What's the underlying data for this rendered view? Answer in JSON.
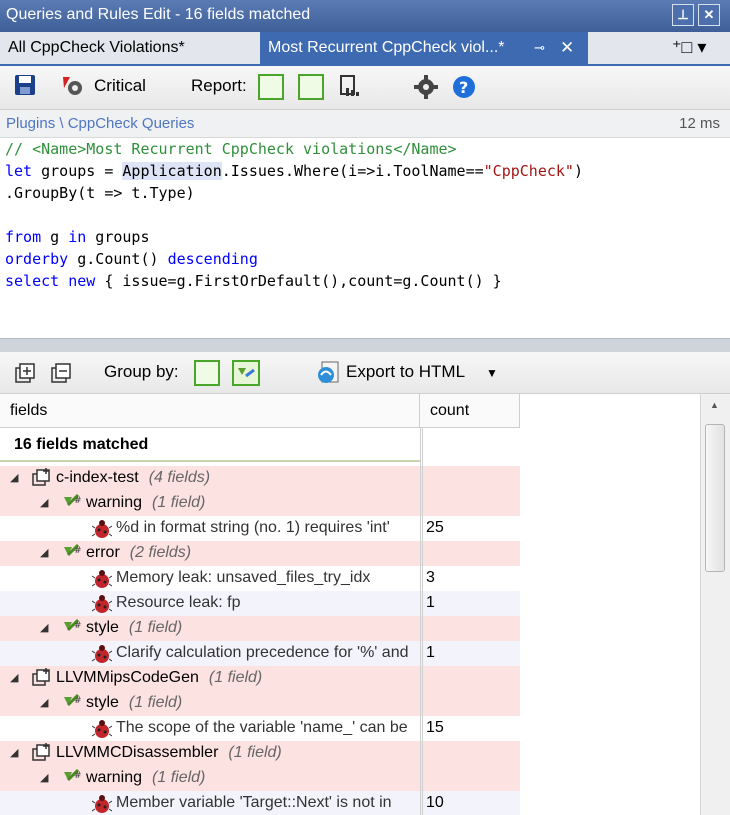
{
  "window": {
    "title": "Queries and Rules Edit  - 16 fields matched"
  },
  "tabs": [
    {
      "label": "All CppCheck Violations*"
    },
    {
      "label": "Most Recurrent CppCheck viol...*"
    }
  ],
  "toolbar": {
    "critical_label": "Critical",
    "report_label": "Report:"
  },
  "path": {
    "text": "Plugins \\ CppCheck Queries",
    "timing": "12 ms"
  },
  "code": {
    "l1_a": "// <Name>",
    "l1_b": "Most Recurrent CppCheck violations",
    "l1_c": "</Name>",
    "l2_a": "let",
    "l2_b": " groups = ",
    "l2_c": "Application",
    "l2_d": ".Issues.Where(i=>i.ToolName==",
    "l2_e": "\"CppCheck\"",
    "l2_f": ")",
    "l3": ".GroupBy(t => t.Type)",
    "l5_a": "from",
    "l5_b": " g ",
    "l5_c": "in",
    "l5_d": " groups",
    "l6_a": "orderby",
    "l6_b": " g.Count() ",
    "l6_c": "descending",
    "l7_a": "select",
    "l7_b": " ",
    "l7_c": "new",
    "l7_d": " { issue=g.FirstOrDefault(),count=g.Count() }"
  },
  "results_toolbar": {
    "groupby_label": "Group by:",
    "export_label": "Export to HTML"
  },
  "grid": {
    "col_fields": "fields",
    "col_count": "count",
    "matched": "16 fields matched",
    "rows": [
      {
        "text": "c-index-test",
        "sub": "(4 fields)",
        "count": ""
      },
      {
        "text": "warning",
        "sub": "(1 field)",
        "count": ""
      },
      {
        "text": "%d in format string (no. 1) requires 'int'",
        "sub": "",
        "count": "25"
      },
      {
        "text": "error",
        "sub": "(2 fields)",
        "count": ""
      },
      {
        "text": "Memory leak: unsaved_files_try_idx",
        "sub": "",
        "count": "3"
      },
      {
        "text": "Resource leak: fp",
        "sub": "",
        "count": "1"
      },
      {
        "text": "style",
        "sub": "(1 field)",
        "count": ""
      },
      {
        "text": "Clarify calculation precedence for '%' and",
        "sub": "",
        "count": "1"
      },
      {
        "text": "LLVMMipsCodeGen",
        "sub": "(1 field)",
        "count": ""
      },
      {
        "text": "style",
        "sub": "(1 field)",
        "count": ""
      },
      {
        "text": "The scope of the variable 'name_' can be",
        "sub": "",
        "count": "15"
      },
      {
        "text": "LLVMMCDisassembler",
        "sub": "(1 field)",
        "count": ""
      },
      {
        "text": "warning",
        "sub": "(1 field)",
        "count": ""
      },
      {
        "text": "Member variable 'Target::Next' is not in",
        "sub": "",
        "count": "10"
      }
    ]
  },
  "colors": {
    "accent": "#3d6ab0",
    "group_row": "#fde2e2",
    "item_row": "#f3f3fb",
    "comment": "#2f8f3a",
    "keyword": "#0000ff"
  },
  "icons": [
    "pin-icon",
    "close-icon",
    "new-tab-icon",
    "save-icon",
    "critical-rule-icon",
    "report-icon",
    "settings-icon",
    "help-icon",
    "expand-all-icon",
    "collapse-all-icon",
    "group-by-icon",
    "export-html-icon",
    "expander-icon",
    "project-icon",
    "rule-type-icon",
    "issue-bug-icon"
  ]
}
